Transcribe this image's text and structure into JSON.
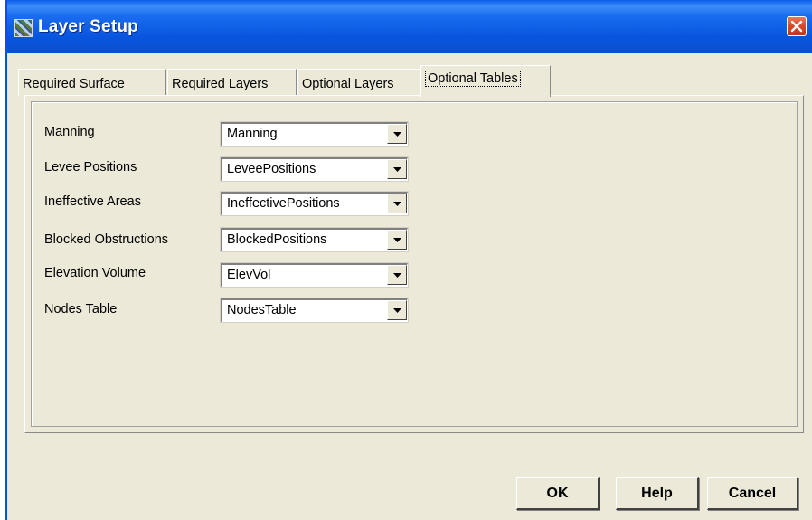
{
  "window": {
    "title": "Layer Setup",
    "titlebar_color": "#0a55dd",
    "close_color": "#d6482a"
  },
  "tabs": [
    {
      "label": "Required Surface",
      "active": false
    },
    {
      "label": "Required Layers",
      "active": false
    },
    {
      "label": "Optional Layers",
      "active": false
    },
    {
      "label": "Optional Tables",
      "active": true
    }
  ],
  "fields": [
    {
      "label": "Manning",
      "value": "Manning"
    },
    {
      "label": "Levee Positions",
      "value": "LeveePositions"
    },
    {
      "label": "Ineffective Areas",
      "value": "IneffectivePositions"
    },
    {
      "label": "Blocked Obstructions",
      "value": "BlockedPositions"
    },
    {
      "label": "Elevation Volume",
      "value": "ElevVol"
    },
    {
      "label": "Nodes Table",
      "value": "NodesTable"
    }
  ],
  "buttons": {
    "ok": "OK",
    "help": "Help",
    "cancel": "Cancel"
  },
  "icons": {
    "app": "layer-setup-app-icon",
    "close": "close-icon",
    "dropdown": "chevron-down-icon"
  }
}
